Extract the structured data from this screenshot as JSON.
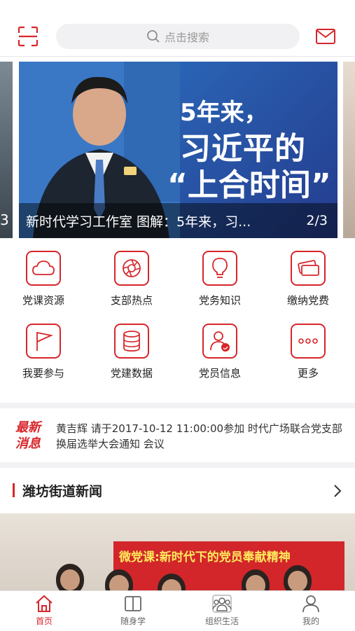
{
  "search": {
    "placeholder": "点击搜索"
  },
  "banner": {
    "left_page_fragment": "3",
    "headline_line1": "5年来，",
    "headline_line2": "习近平的",
    "headline_line3": "“上合时间”",
    "caption": "新时代学习工作室 图解：5年来，习...",
    "page_indicator": "2/3"
  },
  "grid": {
    "items": [
      {
        "label": "党课资源",
        "icon": "cloud-icon"
      },
      {
        "label": "支部热点",
        "icon": "aperture-icon"
      },
      {
        "label": "党务知识",
        "icon": "lightbulb-icon"
      },
      {
        "label": "缴纳党费",
        "icon": "cards-icon"
      },
      {
        "label": "我要参与",
        "icon": "flag-icon"
      },
      {
        "label": "党建数据",
        "icon": "database-icon"
      },
      {
        "label": "党员信息",
        "icon": "member-icon"
      },
      {
        "label": "更多",
        "icon": "more-icon"
      }
    ]
  },
  "latest_news": {
    "tag_line1": "最新",
    "tag_line2": "消息",
    "text": "黄吉辉 请于2017-10-12 11:00:00参加 时代广场联合党支部换届选举大会通知 会议"
  },
  "section": {
    "title": "潍坊街道新闻"
  },
  "photo": {
    "banner_text": "微党课:新时代下的党员奉献精神"
  },
  "tabbar": {
    "items": [
      {
        "label": "首页",
        "icon": "home-icon",
        "active": true
      },
      {
        "label": "随身学",
        "icon": "book-icon",
        "active": false
      },
      {
        "label": "组织生活",
        "icon": "group-icon",
        "active": false
      },
      {
        "label": "我的",
        "icon": "user-icon",
        "active": false
      }
    ]
  },
  "colors": {
    "accent": "#d7262b",
    "background": "#ffffff",
    "band": "#f2f2f4"
  }
}
